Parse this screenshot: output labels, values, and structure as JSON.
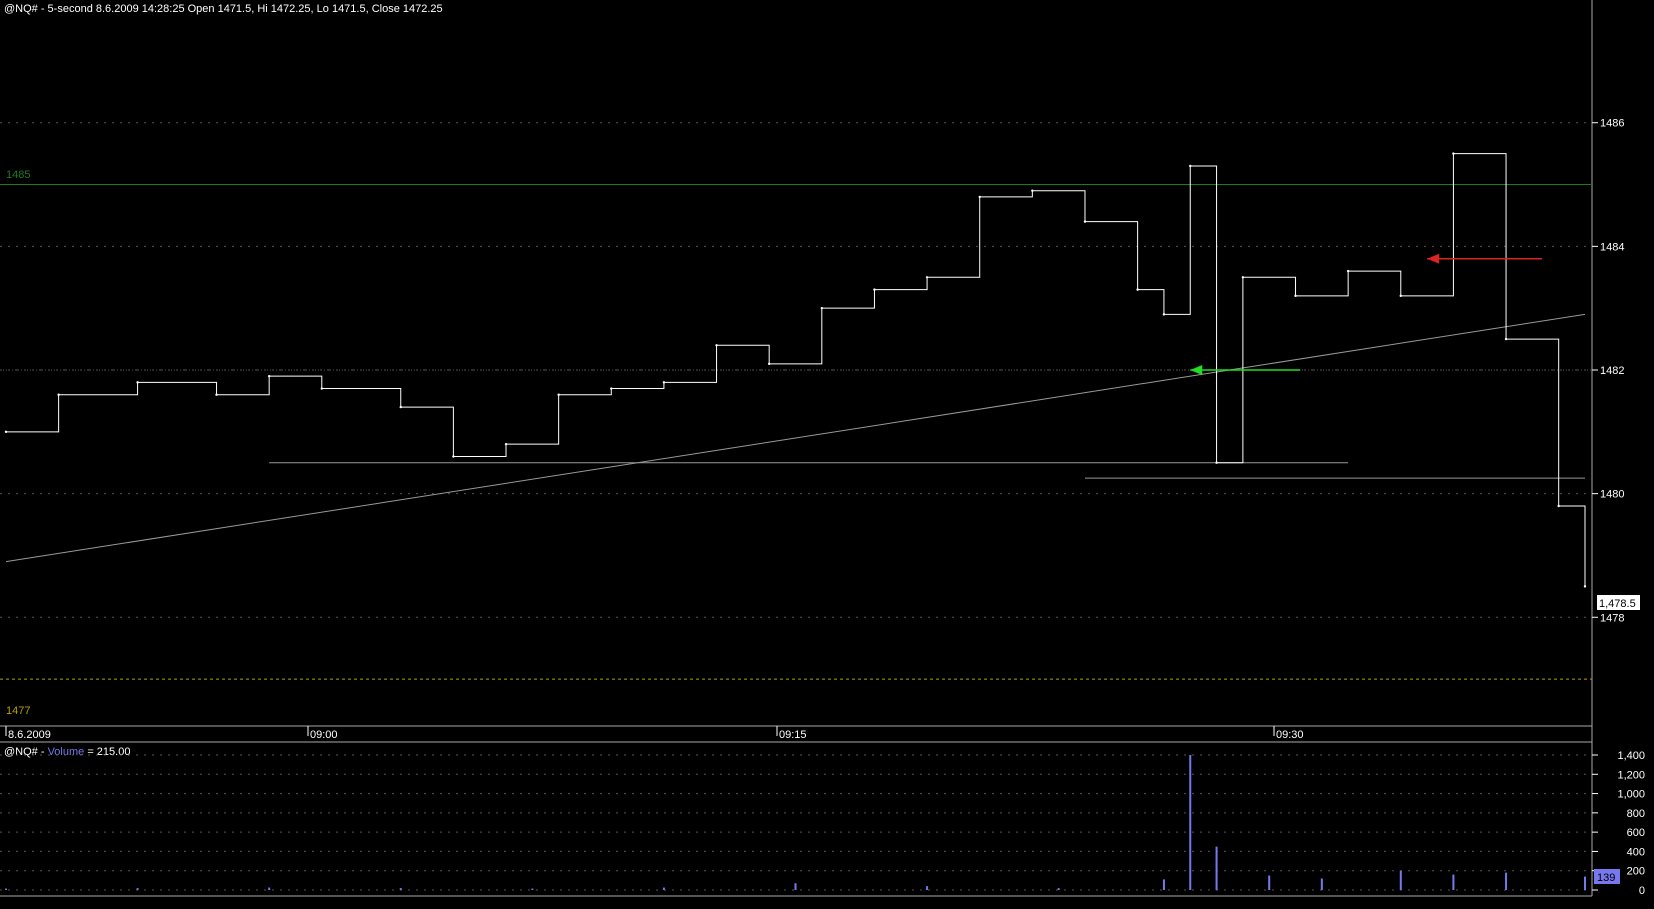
{
  "price_header": {
    "symbol": "@NQ#",
    "interval": "5-second",
    "datetime": "8.6.2009 14:28:25",
    "text": "@NQ# - 5-second 8.6.2009 14:28:25 Open 1471.5, Hi 1472.25, Lo 1471.5, Close 1472.25"
  },
  "volume_header": {
    "prefix": "@NQ# - ",
    "study": "Volume",
    "value_text": " = 215.00"
  },
  "price_axis": {
    "ticks": [
      "1486",
      "1484",
      "1482",
      "1480",
      "1478"
    ],
    "last_price": "1,478.5",
    "level_high": "1485",
    "level_low": "1477"
  },
  "time_axis": {
    "labels": [
      "8.6.2009",
      "09:00",
      "09:15",
      "09:30"
    ]
  },
  "volume_axis": {
    "ticks": [
      "1,400",
      "1,200",
      "1,000",
      "800",
      "600",
      "400",
      "200",
      "0"
    ],
    "last_volume": "139"
  },
  "colors": {
    "background": "#000000",
    "price_line": "#ffffff",
    "grid": "#555555",
    "level_high": "#1f7a1f",
    "level_low": "#b8a000",
    "volume": "#7777ee",
    "buy_arrow": "#22dd22",
    "sell_arrow": "#dd2222"
  },
  "chart_data": [
    {
      "type": "line",
      "panel": "price",
      "ylim": [
        1476.5,
        1487.5
      ],
      "x": [
        "08:45",
        "08:47",
        "08:50",
        "08:53",
        "08:55",
        "08:57",
        "09:00",
        "09:02",
        "09:04",
        "09:06",
        "09:08",
        "09:10",
        "09:12",
        "09:14",
        "09:16",
        "09:18",
        "09:20",
        "09:22",
        "09:24",
        "09:26",
        "09:28",
        "09:29",
        "09:30",
        "09:31",
        "09:32",
        "09:34",
        "09:36",
        "09:38",
        "09:40",
        "09:42",
        "09:44",
        "09:45"
      ],
      "values": [
        1481.0,
        1481.6,
        1481.8,
        1481.6,
        1481.9,
        1481.7,
        1481.4,
        1480.6,
        1480.8,
        1481.6,
        1481.7,
        1481.8,
        1482.4,
        1482.1,
        1483.0,
        1483.3,
        1483.5,
        1484.8,
        1484.9,
        1484.4,
        1483.3,
        1482.9,
        1485.3,
        1480.5,
        1483.5,
        1483.2,
        1483.6,
        1483.2,
        1485.5,
        1482.5,
        1479.8,
        1478.5
      ],
      "lines": [
        {
          "kind": "horizontal",
          "value": 1485.0
        },
        {
          "kind": "horizontal",
          "value": 1477.0
        },
        {
          "kind": "horizontal",
          "value": 1482.0
        },
        {
          "kind": "horizontal-segment",
          "value": 1480.5,
          "x_from": "08:55",
          "x_to": "09:36"
        },
        {
          "kind": "horizontal-segment",
          "value": 1480.25,
          "x_from": "09:26",
          "x_to": "09:45"
        },
        {
          "kind": "trendline",
          "from": [
            "08:45",
            1478.9
          ],
          "to": [
            "09:45",
            1482.9
          ]
        }
      ],
      "annotations": [
        {
          "kind": "buy-arrow",
          "x": "09:30",
          "value": 1482.0
        },
        {
          "kind": "sell-arrow",
          "x": "09:39",
          "value": 1483.8
        }
      ]
    },
    {
      "type": "bar",
      "panel": "volume",
      "ylim": [
        0,
        1400
      ],
      "x": [
        "08:45",
        "08:50",
        "08:55",
        "09:00",
        "09:05",
        "09:10",
        "09:15",
        "09:20",
        "09:25",
        "09:29",
        "09:30",
        "09:31",
        "09:33",
        "09:35",
        "09:38",
        "09:40",
        "09:42",
        "09:45"
      ],
      "values": [
        15,
        20,
        25,
        20,
        15,
        25,
        70,
        40,
        20,
        110,
        1400,
        450,
        150,
        120,
        200,
        160,
        180,
        139
      ]
    }
  ]
}
